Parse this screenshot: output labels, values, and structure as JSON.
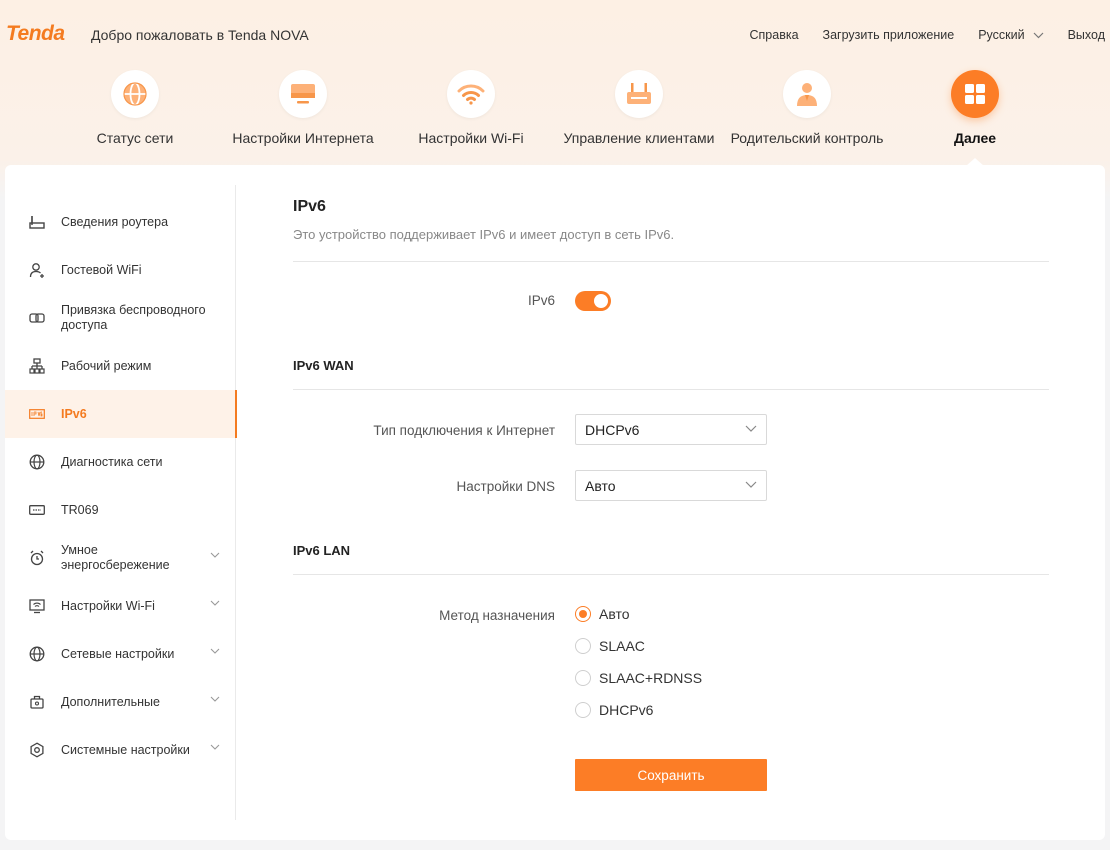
{
  "header": {
    "logo": "Tenda",
    "welcome": "Добро пожаловать в Tenda NOVA",
    "links": {
      "help": "Справка",
      "download": "Загрузить приложение",
      "language": "Русский",
      "logout": "Выход"
    }
  },
  "nav": {
    "items": [
      {
        "label": "Статус сети",
        "icon": "globe-icon"
      },
      {
        "label": "Настройки Интернета",
        "icon": "monitor-icon"
      },
      {
        "label": "Настройки Wi-Fi",
        "icon": "wifi-icon"
      },
      {
        "label": "Управление клиентами",
        "icon": "router-icon"
      },
      {
        "label": "Родительский контроль",
        "icon": "parent-icon"
      },
      {
        "label": "Далее",
        "icon": "grid-icon",
        "active": true
      }
    ]
  },
  "sidebar": {
    "items": [
      {
        "label": "Сведения роутера",
        "icon": "router-info-icon"
      },
      {
        "label": "Гостевой WiFi",
        "icon": "guest-user-icon"
      },
      {
        "label": "Привязка беспроводного доступа",
        "icon": "link-icon"
      },
      {
        "label": "Рабочий режим",
        "icon": "topology-icon"
      },
      {
        "label": "IPv6",
        "icon": "ipv6-icon",
        "active": true
      },
      {
        "label": "Диагностика сети",
        "icon": "globe-icon"
      },
      {
        "label": "TR069",
        "icon": "tr069-icon"
      },
      {
        "label": "Умное энергосбережение",
        "icon": "alarm-icon",
        "expandable": true
      },
      {
        "label": "Настройки Wi-Fi",
        "icon": "wifi-settings-icon",
        "expandable": true
      },
      {
        "label": "Сетевые настройки",
        "icon": "globe-icon",
        "expandable": true
      },
      {
        "label": "Дополнительные",
        "icon": "toolbox-icon",
        "expandable": true
      },
      {
        "label": "Системные настройки",
        "icon": "gear-icon",
        "expandable": true
      }
    ]
  },
  "content": {
    "title": "IPv6",
    "description": "Это устройство поддерживает IPv6 и имеет доступ в сеть IPv6.",
    "ipv6_toggle": {
      "label": "IPv6",
      "enabled": true
    },
    "wan": {
      "section_title": "IPv6 WAN",
      "connection_type": {
        "label": "Тип подключения к Интернет",
        "value": "DHCPv6"
      },
      "dns": {
        "label": "Настройки DNS",
        "value": "Авто"
      }
    },
    "lan": {
      "section_title": "IPv6 LAN",
      "method_label": "Метод назначения",
      "options": [
        "Авто",
        "SLAAC",
        "SLAAC+RDNSS",
        "DHCPv6"
      ],
      "selected": "Авто"
    },
    "save_label": "Сохранить"
  },
  "colors": {
    "accent": "#fc7d26",
    "accent_light": "#fef2e8"
  }
}
